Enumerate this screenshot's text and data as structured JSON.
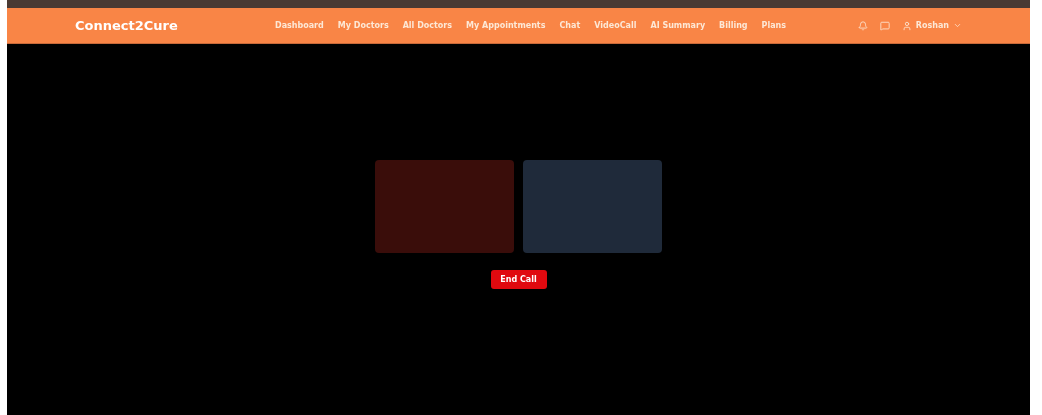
{
  "navbar": {
    "brand": "Connect2Cure",
    "links": [
      "Dashboard",
      "My Doctors",
      "All Doctors",
      "My Appointments",
      "Chat",
      "VideoCall",
      "AI Summary",
      "Billing",
      "Plans"
    ],
    "user": "Roshan"
  },
  "call": {
    "tiles": [
      {
        "kind": "local"
      },
      {
        "kind": "remote"
      }
    ],
    "end_button": "End Call"
  }
}
